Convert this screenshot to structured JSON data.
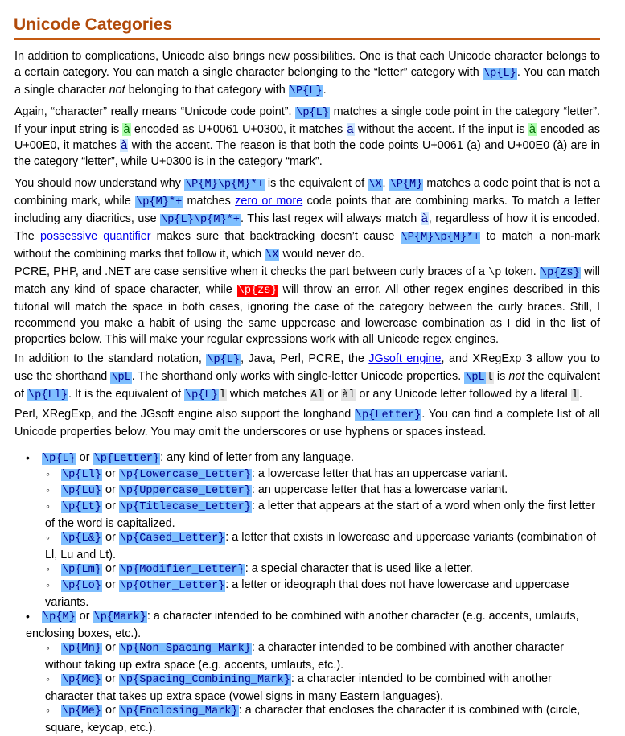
{
  "title": "Unicode Categories",
  "p1": {
    "t1": "In addition to complications, Unicode also brings new possibilities. One is that each Unicode character belongs to a certain category. You can match a single character belonging to the “letter” category with ",
    "r1": "\\p{L}",
    "t2": ". You can match a single character ",
    "em": "not",
    "t3": " belonging to that category with ",
    "r2": "\\P{L}",
    "t4": "."
  },
  "p2": {
    "t1": "Again, “character” really means “Unicode code point”. ",
    "r1": "\\p{L}",
    "t2": " matches a single code point in the category “letter”. If your input string is ",
    "s1": "à",
    "t3": " encoded as U+0061 U+0300, it matches ",
    "s2": "a",
    "t4": " without the accent. If the input is ",
    "s3": "à",
    "t5": " encoded as U+00E0, it matches ",
    "s4": "à",
    "t6": " with the accent. The reason is that both the code points U+0061 (a) and U+00E0 (à) are in the category “letter”, while U+0300 is in the category “mark”."
  },
  "p3": {
    "t1": "You should now understand why ",
    "r1": "\\P{M}\\p{M}*+",
    "t2": " is the equivalent of ",
    "r2": "\\X",
    "t3": ". ",
    "r3": "\\P{M}",
    "t4": " matches a code point that is not a combining mark, while ",
    "r4": "\\p{M}*+",
    "t5": " matches ",
    "l1": "zero or more",
    "t6": " code points that are combining marks. To match a letter including any diacritics, use ",
    "r5": "\\p{L}\\p{M}*+",
    "t7": ". This last regex will always match ",
    "s1": "à",
    "t8": ", regardless of how it is encoded. The ",
    "l2": "possessive quantifier",
    "t9": " makes sure that backtracking doesn’t cause ",
    "r6": "\\P{M}\\p{M}*+",
    "t10": " to match a non-mark without the combining marks that follow it, which ",
    "r7": "\\X",
    "t11": " would never do."
  },
  "p4": {
    "t1": "PCRE, PHP, and .NET are case sensitive when it checks the part between curly braces of a ",
    "c1": "\\p",
    "t2": " token. ",
    "r1": "\\p{Zs}",
    "t3": " will match any kind of space character, while ",
    "r2": "\\p{zs}",
    "t4": " will throw an error. All other regex engines described in this tutorial will match the space in both cases, ignoring the case of the category between the curly braces. Still, I recommend you make a habit of using the same uppercase and lowercase combination as I did in the list of properties below. This will make your regular expressions work with all Unicode regex engines."
  },
  "p5": {
    "t1": "In addition to the standard notation, ",
    "r1": "\\p{L}",
    "t2": ", Java, Perl, PCRE, the ",
    "l1": "JGsoft engine",
    "t3": ", and XRegExp 3 allow you to use the shorthand ",
    "r2": "\\pL",
    "t4": ". The shorthand only works with single-letter Unicode properties. ",
    "r3": "\\pL",
    "r3b": "l",
    "t5": " is ",
    "em": "not",
    "t6": " the equivalent of ",
    "r4": "\\p{Ll}",
    "t7": ". It is the equivalent of ",
    "r5": "\\p{L}",
    "r5b": "l",
    "t8": " which matches ",
    "s1": "Al",
    "t9": " or ",
    "s2": "àl",
    "t10": " or any Unicode letter followed by a literal ",
    "s3": "l",
    "t11": "."
  },
  "p6": {
    "t1": "Perl, XRegExp, and the JGsoft engine also support the longhand ",
    "r1": "\\p{Letter}",
    "t2": ". You can find a complete list of all Unicode properties below. You may omit the underscores or use hyphens or spaces instead."
  },
  "list": {
    "or": "or",
    "L": {
      "a": "\\p{L}",
      "b": "\\p{Letter}",
      "d": ": any kind of letter from any language."
    },
    "Ll": {
      "a": "\\p{Ll}",
      "b": "\\p{Lowercase_Letter}",
      "d": ": a lowercase letter that has an uppercase variant."
    },
    "Lu": {
      "a": "\\p{Lu}",
      "b": "\\p{Uppercase_Letter}",
      "d": ": an uppercase letter that has a lowercase variant."
    },
    "Lt": {
      "a": "\\p{Lt}",
      "b": "\\p{Titlecase_Letter}",
      "d": ": a letter that appears at the start of a word when only the first letter of the word is capitalized."
    },
    "LC": {
      "a": "\\p{L&}",
      "b": "\\p{Cased_Letter}",
      "d": ": a letter that exists in lowercase and uppercase variants (combination of Ll, Lu and Lt)."
    },
    "Lm": {
      "a": "\\p{Lm}",
      "b": "\\p{Modifier_Letter}",
      "d": ": a special character that is used like a letter."
    },
    "Lo": {
      "a": "\\p{Lo}",
      "b": "\\p{Other_Letter}",
      "d": ": a letter or ideograph that does not have lowercase and uppercase variants."
    },
    "M": {
      "a": "\\p{M}",
      "b": "\\p{Mark}",
      "d": ": a character intended to be combined with another character (e.g. accents, umlauts, enclosing boxes, etc.)."
    },
    "Mn": {
      "a": "\\p{Mn}",
      "b": "\\p{Non_Spacing_Mark}",
      "d": ": a character intended to be combined with another character without taking up extra space (e.g. accents, umlauts, etc.)."
    },
    "Mc": {
      "a": "\\p{Mc}",
      "b": "\\p{Spacing_Combining_Mark}",
      "d": ": a character intended to be combined with another character that takes up extra space (vowel signs in many Eastern languages)."
    },
    "Me": {
      "a": "\\p{Me}",
      "b": "\\p{Enclosing_Mark}",
      "d": ": a character that encloses the character it is combined with (circle, square, keycap, etc.)."
    }
  },
  "colors": {
    "heading": "#b14a0a",
    "regex_bg": "#7fbfff",
    "error_bg": "#ff0000",
    "link": "#0000ee"
  }
}
